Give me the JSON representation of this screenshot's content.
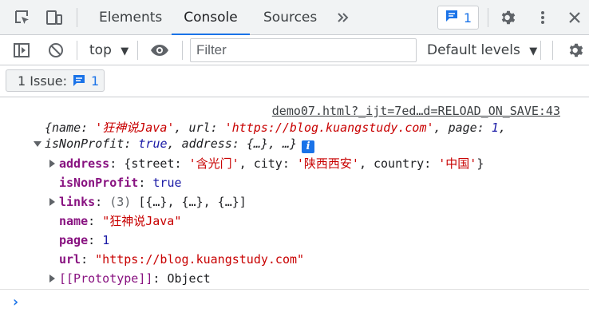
{
  "tabs": [
    {
      "label": "Elements"
    },
    {
      "label": "Console"
    },
    {
      "label": "Sources"
    }
  ],
  "messages_badge": {
    "count": "1"
  },
  "toolbar": {
    "context": "top",
    "filter_placeholder": "Filter",
    "filter_value": "",
    "levels": "Default levels"
  },
  "issues": {
    "label": "1 Issue:",
    "count": "1"
  },
  "colors": {
    "accent": "#1a73e8",
    "key": "#881280",
    "string": "#c80000",
    "number": "#1a1aa6"
  },
  "log": {
    "source": "demo07.html?_ijt=7ed…d=RELOAD_ON_SAVE:43",
    "preview": {
      "k_name": "name",
      "v_name": "'狂神说Java'",
      "k_url": "url",
      "v_url": "'https://blog.kuangstudy.com'",
      "k_page": "page",
      "v_page": "1",
      "k_nonprofit": "isNonProfit",
      "v_nonprofit": "true",
      "k_address": "address",
      "v_address": "{…}",
      "tail": "…}"
    },
    "props": {
      "address": {
        "key": "address",
        "street_key": "street",
        "street": "'含光门'",
        "city_key": "city",
        "city": "'陕西西安'",
        "country_key": "country",
        "country": "'中国'"
      },
      "isNonProfit": {
        "key": "isNonProfit",
        "value": "true"
      },
      "links": {
        "key": "links",
        "count": "(3)",
        "value": "[{…}, {…}, {…}]"
      },
      "name": {
        "key": "name",
        "value": "\"狂神说Java\""
      },
      "page": {
        "key": "page",
        "value": "1"
      },
      "url": {
        "key": "url",
        "value": "\"https://blog.kuangstudy.com\""
      },
      "prototype": {
        "key": "[[Prototype]]",
        "value": "Object"
      }
    }
  },
  "prompt": "›"
}
